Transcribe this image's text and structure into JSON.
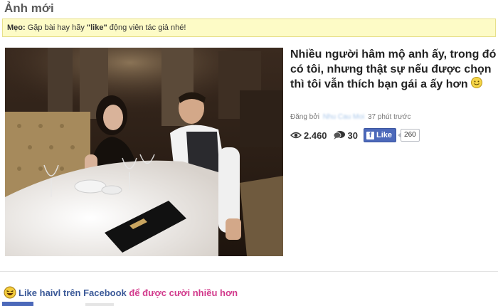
{
  "header": {
    "title": "Ảnh mới"
  },
  "tip": {
    "label": "Mẹo:",
    "text_before": "Gặp bài hay hãy ",
    "highlight": "\"like\"",
    "text_after": " động viên tác giả nhé!"
  },
  "post": {
    "title": "Nhiều người hâm mộ anh ấy, trong đó có tôi, nhưng thật sự nếu được chọn thì tôi vẫn thích bạn gái a ấy hơn",
    "emoji_icon": "smile-emoji",
    "posted_by": "Đăng bởi",
    "author": "Nhu Cau Moi",
    "time": "37 phút trước",
    "views": "2.460",
    "comments": "30",
    "like_label": "Like",
    "like_count": "260"
  },
  "promo": {
    "w1": "Like",
    "w2": "haivl",
    "w3": "trên",
    "w4": "Facebook",
    "w5": "để được cười nhiều hơn"
  },
  "colors": {
    "facebook_blue": "#4c69ba",
    "tip_bg": "#fdfbc6",
    "promo_pink": "#d23a8c"
  }
}
